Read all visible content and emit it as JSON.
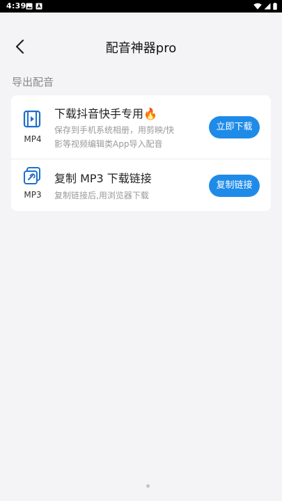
{
  "status_bar": {
    "time": "4:39"
  },
  "header": {
    "title": "配音神器pro"
  },
  "section": {
    "label": "导出配音"
  },
  "items": [
    {
      "format": "MP4",
      "title": "下载抖音快手专用",
      "title_emoji": "🔥",
      "desc_line1": "保存到手机系统相册，用剪映/快",
      "desc_line2": "影等视频编辑类App导入配音",
      "button": "立即下载",
      "icon": "video-file-icon"
    },
    {
      "format": "MP3",
      "title": "复制 MP3 下载链接",
      "desc_line1": "复制链接后,用浏览器下载",
      "button": "复制链接",
      "icon": "link-file-icon"
    }
  ],
  "colors": {
    "accent": "#1e8be8",
    "background": "#f4f4f6"
  }
}
